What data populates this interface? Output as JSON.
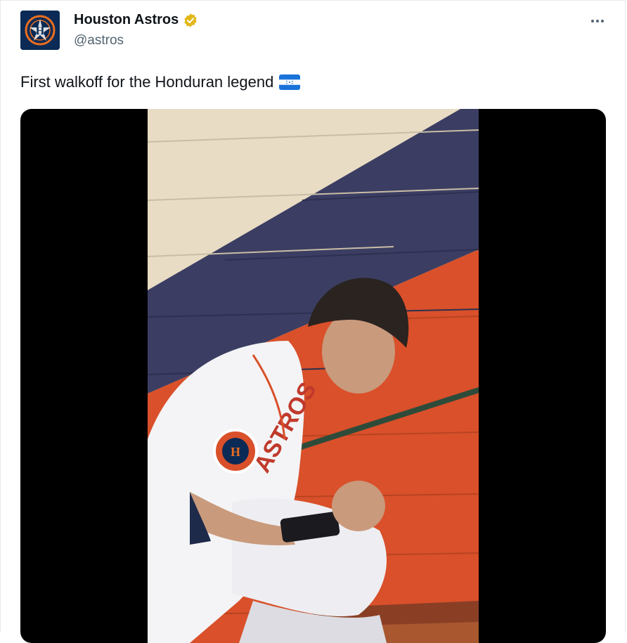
{
  "tweet": {
    "display_name": "Houston Astros",
    "handle": "@astros",
    "text": "First walkoff for the Honduran legend",
    "verified": true
  },
  "icons": {
    "avatar": "astros-logo",
    "verified": "verified-badge-icon",
    "more": "more-options-icon",
    "flag": "honduras-flag-emoji"
  },
  "colors": {
    "verified_gold": "#e2b719",
    "astros_navy": "#0b2a55",
    "astros_orange": "#eb6e1f",
    "flag_blue": "#1a73d9"
  }
}
